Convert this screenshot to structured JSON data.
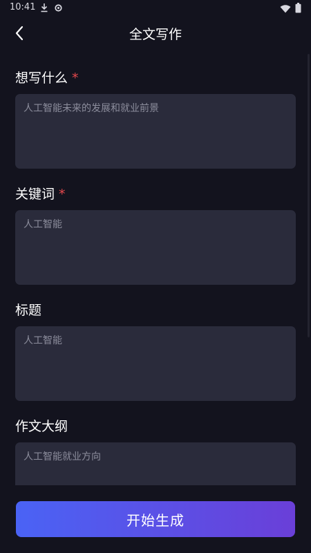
{
  "status_bar": {
    "time": "10:41"
  },
  "header": {
    "title": "全文写作"
  },
  "form": {
    "fields": [
      {
        "label": "想写什么",
        "required": true,
        "placeholder": "人工智能未来的发展和就业前景"
      },
      {
        "label": "关键词",
        "required": true,
        "placeholder": "人工智能"
      },
      {
        "label": "标题",
        "required": false,
        "placeholder": "人工智能"
      },
      {
        "label": "作文大纲",
        "required": false,
        "placeholder": "人工智能就业方向"
      }
    ],
    "required_mark": "*"
  },
  "actions": {
    "generate_label": "开始生成"
  },
  "colors": {
    "background": "#13131e",
    "field_bg": "#2a2b3b",
    "required": "#e5484d",
    "button_start": "#4a63f5",
    "button_end": "#6a3fd8"
  },
  "icons": [
    "download-icon",
    "settings-gear-icon",
    "wifi-icon",
    "battery-icon",
    "back-arrow-icon"
  ]
}
